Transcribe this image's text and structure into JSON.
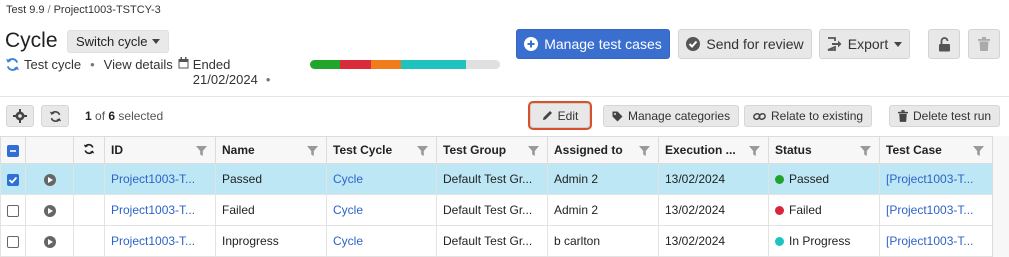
{
  "breadcrumb": {
    "part1": "Test 9.9",
    "separator": "/",
    "part2": "Project1003-TSTCY-3"
  },
  "header": {
    "title": "Cycle",
    "switch_label": "Switch cycle",
    "meta_test_cycle": "Test cycle",
    "meta_view_details": "View details",
    "meta_ended_label": "Ended",
    "meta_ended_date": "21/02/2024",
    "bullet": "•"
  },
  "progress": {
    "segments": [
      {
        "color": "#22a52b",
        "fraction": 0.16
      },
      {
        "color": "#d92b3a",
        "fraction": 0.16
      },
      {
        "color": "#f07c1b",
        "fraction": 0.16
      },
      {
        "color": "#1ec3c0",
        "fraction": 0.34
      },
      {
        "color": "#e0e0e0",
        "fraction": 0.18
      }
    ]
  },
  "actions": {
    "manage_test_cases": "Manage test cases",
    "send_for_review": "Send for review",
    "export": "Export"
  },
  "toolbar": {
    "selected_count": "1",
    "selected_of": "of",
    "selected_total": "6",
    "selected_suffix": "selected",
    "edit": "Edit",
    "manage_categories": "Manage categories",
    "relate_to_existing": "Relate to existing",
    "delete_test_run": "Delete test run"
  },
  "table": {
    "headers": [
      "ID",
      "Name",
      "Test Cycle",
      "Test Group",
      "Assigned to",
      "Execution ...",
      "Status",
      "Test Case"
    ],
    "rows": [
      {
        "checked": true,
        "id": "Project1003-T...",
        "name": "Passed",
        "cycle": "Cycle",
        "group": "Default Test Gr...",
        "assigned": "Admin 2",
        "execution": "13/02/2024",
        "status": "Passed",
        "status_color": "#1fa32a",
        "test_case": "[Project1003-T..."
      },
      {
        "checked": false,
        "id": "Project1003-T...",
        "name": "Failed",
        "cycle": "Cycle",
        "group": "Default Test Gr...",
        "assigned": "Admin 2",
        "execution": "13/02/2024",
        "status": "Failed",
        "status_color": "#d9263a",
        "test_case": "[Project1003-T..."
      },
      {
        "checked": false,
        "id": "Project1003-T...",
        "name": "Inprogress",
        "cycle": "Cycle",
        "group": "Default Test Gr...",
        "assigned": "b carlton",
        "execution": "13/02/2024",
        "status": "In Progress",
        "status_color": "#1ec3c0",
        "test_case": "[Project1003-T..."
      }
    ]
  },
  "icons": {
    "caret": "chevron-down-icon",
    "refresh": "refresh-icon",
    "calendar": "calendar-icon",
    "plus": "plus-circle-icon",
    "check": "check-circle-icon",
    "export": "export-icon",
    "lock": "unlock-icon",
    "trash": "trash-icon",
    "gear": "gear-icon",
    "pencil": "pencil-icon",
    "tag": "tag-icon",
    "link": "link-icon",
    "filter": "filter-icon",
    "play": "play-icon"
  }
}
